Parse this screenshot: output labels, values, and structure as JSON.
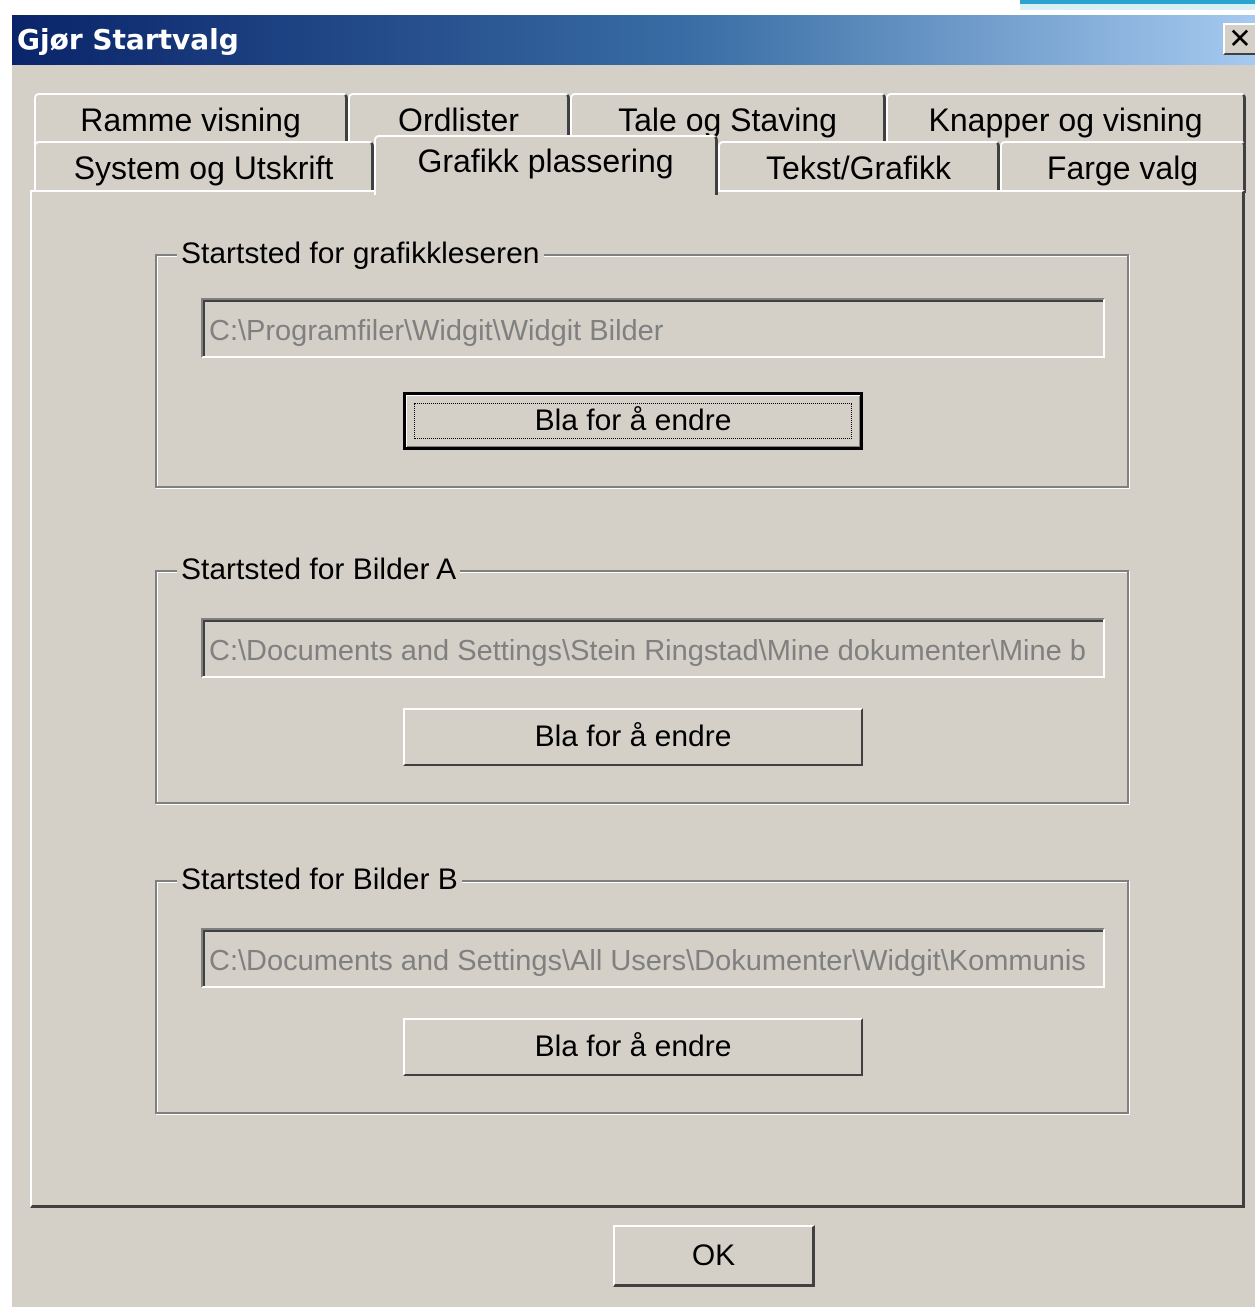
{
  "window": {
    "title": "Gjør Startvalg",
    "close_glyph": "✕"
  },
  "tabs_row1": [
    {
      "label": "Ramme visning"
    },
    {
      "label": "Ordlister"
    },
    {
      "label": "Tale og Staving"
    },
    {
      "label": "Knapper og visning"
    }
  ],
  "tabs_row2": [
    {
      "label": "System og Utskrift"
    },
    {
      "label": "Grafikk plassering",
      "active": true
    },
    {
      "label": "Tekst/Grafikk"
    },
    {
      "label": "Farge valg"
    }
  ],
  "groups": [
    {
      "label": "Startsted for grafikkleseren",
      "path": "C:\\Programfiler\\Widgit\\Widgit Bilder",
      "button": "Bla for å endre"
    },
    {
      "label": "Startsted for Bilder A",
      "path": "C:\\Documents and Settings\\Stein Ringstad\\Mine dokumenter\\Mine b",
      "button": "Bla for å endre"
    },
    {
      "label": "Startsted for Bilder B",
      "path": "C:\\Documents and Settings\\All Users\\Dokumenter\\Widgit\\Kommunis",
      "button": "Bla for å endre"
    }
  ],
  "ok_label": "OK",
  "icons": {
    "close": "close-icon"
  },
  "colors": {
    "dialog_bg": "#d4d0c8",
    "title_start": "#0a246a",
    "title_end": "#a6caf0",
    "disabled_text": "#808080"
  }
}
